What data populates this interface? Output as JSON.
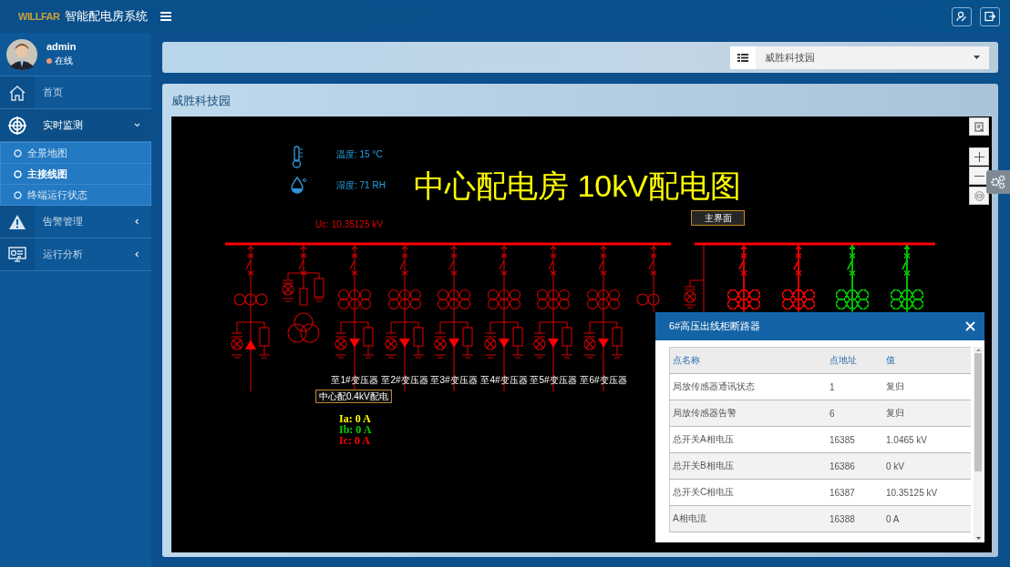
{
  "app": {
    "logo": "WILLFAR",
    "title": "智能配电房系统"
  },
  "user": {
    "name": "admin",
    "status": "在线"
  },
  "menu": [
    {
      "kind": "link",
      "label": "首页",
      "selected": false
    },
    {
      "kind": "group",
      "label": "实时监测",
      "selected": true,
      "expanded": true,
      "children": [
        {
          "label": "全景地图",
          "selected": false
        },
        {
          "label": "主接线图",
          "selected": true
        },
        {
          "label": "终端运行状态",
          "selected": false
        }
      ]
    },
    {
      "kind": "group",
      "label": "告警管理",
      "selected": false,
      "expanded": false
    },
    {
      "kind": "group",
      "label": "运行分析",
      "selected": false,
      "expanded": false
    }
  ],
  "site_select": {
    "value": "威胜科技园"
  },
  "panel": {
    "title": "威胜科技园"
  },
  "diagram": {
    "temperature": "温度: 15 °C",
    "humidity": "湿度: 71 RH",
    "title": "中心配电房 10kV配电图",
    "voltage": "Uc: 10.35125 kV",
    "main_button": "主界面",
    "feeders": [
      {
        "label": "至1#变压器"
      },
      {
        "label": "至2#变压器"
      },
      {
        "label": "至3#变压器"
      },
      {
        "label": "至4#变压器"
      },
      {
        "label": "至5#变压器"
      },
      {
        "label": "至6#变压器"
      }
    ],
    "sub_button": "中心配0.4kV配电",
    "currents": [
      {
        "text": "Ia: 0 A",
        "color": "#ffff00"
      },
      {
        "text": "Ib: 0 A",
        "color": "#00d000"
      },
      {
        "text": "Ic: 0 A",
        "color": "#ff0000"
      }
    ],
    "right_feeders": [
      {
        "color": "#e00000"
      },
      {
        "color": "#e00000"
      },
      {
        "color": "#00c000"
      },
      {
        "color": "#00c000"
      }
    ]
  },
  "popup": {
    "title": "6#高压出线柜断路器",
    "columns": [
      "点名称",
      "点地址",
      "值"
    ],
    "rows": [
      [
        "局放传感器通讯状态",
        "1",
        "复归"
      ],
      [
        "局放传感器告警",
        "6",
        "复归"
      ],
      [
        "总开关A相电压",
        "16385",
        "1.0465 kV"
      ],
      [
        "总开关B相电压",
        "16386",
        "0 kV"
      ],
      [
        "总开关C相电压",
        "16387",
        "10.35125 kV"
      ],
      [
        "A相电流",
        "16388",
        "0 A"
      ]
    ]
  }
}
